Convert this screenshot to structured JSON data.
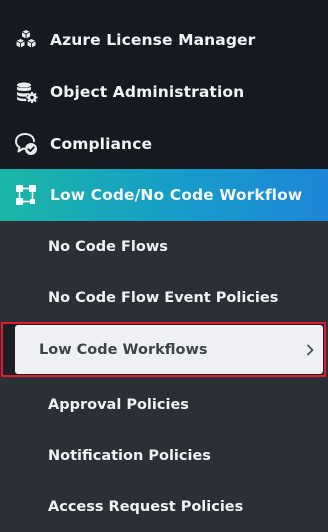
{
  "nav": {
    "items": [
      {
        "label": "Azure License Manager",
        "icon": "cubes-icon"
      },
      {
        "label": "Object Administration",
        "icon": "database-gear-icon"
      },
      {
        "label": "Compliance",
        "icon": "chat-check-icon"
      },
      {
        "label": "Low Code/No Code Workflow",
        "icon": "workflow-nodes-icon",
        "active": true
      }
    ],
    "sub_items": [
      {
        "label": "No Code Flows"
      },
      {
        "label": "No Code Flow Event Policies"
      },
      {
        "label": "Low Code Workflows",
        "selected": true,
        "icon": "chevron-right-icon"
      },
      {
        "label": "Approval Policies"
      },
      {
        "label": "Notification Policies"
      },
      {
        "label": "Access Request Policies"
      }
    ]
  },
  "colors": {
    "top_background": "#151a21",
    "sub_background": "#2b3036",
    "active_gradient_start": "#1bb7a6",
    "active_gradient_end": "#1e86d8",
    "highlight_border": "#e01c2e",
    "selected_background": "#eef0f3"
  }
}
